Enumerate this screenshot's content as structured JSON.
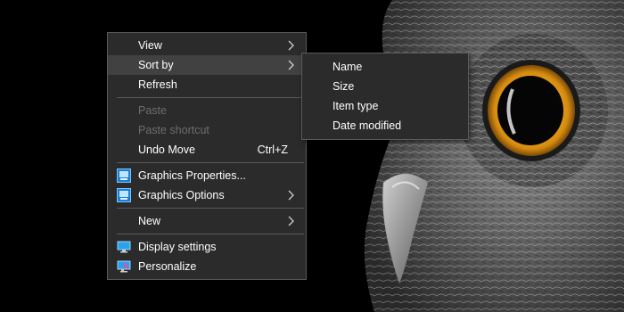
{
  "context_menu": {
    "items": [
      {
        "label": "View",
        "has_submenu": true
      },
      {
        "label": "Sort by",
        "has_submenu": true,
        "highlighted": true
      },
      {
        "label": "Refresh"
      },
      {
        "label": "Paste",
        "disabled": true
      },
      {
        "label": "Paste shortcut",
        "disabled": true
      },
      {
        "label": "Undo Move",
        "shortcut": "Ctrl+Z"
      },
      {
        "label": "Graphics Properties...",
        "icon": "graphics-properties-icon"
      },
      {
        "label": "Graphics Options",
        "icon": "graphics-options-icon",
        "has_submenu": true
      },
      {
        "label": "New",
        "has_submenu": true
      },
      {
        "label": "Display settings",
        "icon": "display-settings-icon"
      },
      {
        "label": "Personalize",
        "icon": "personalize-icon"
      }
    ]
  },
  "sort_by_submenu": {
    "items": [
      {
        "label": "Name"
      },
      {
        "label": "Size"
      },
      {
        "label": "Item type"
      },
      {
        "label": "Date modified"
      }
    ]
  },
  "colors": {
    "menu_background": "#2b2b2b",
    "menu_border": "#5a5a5a",
    "hover_background": "#414141",
    "disabled_text": "#6d6d6d",
    "text": "#ffffff"
  }
}
